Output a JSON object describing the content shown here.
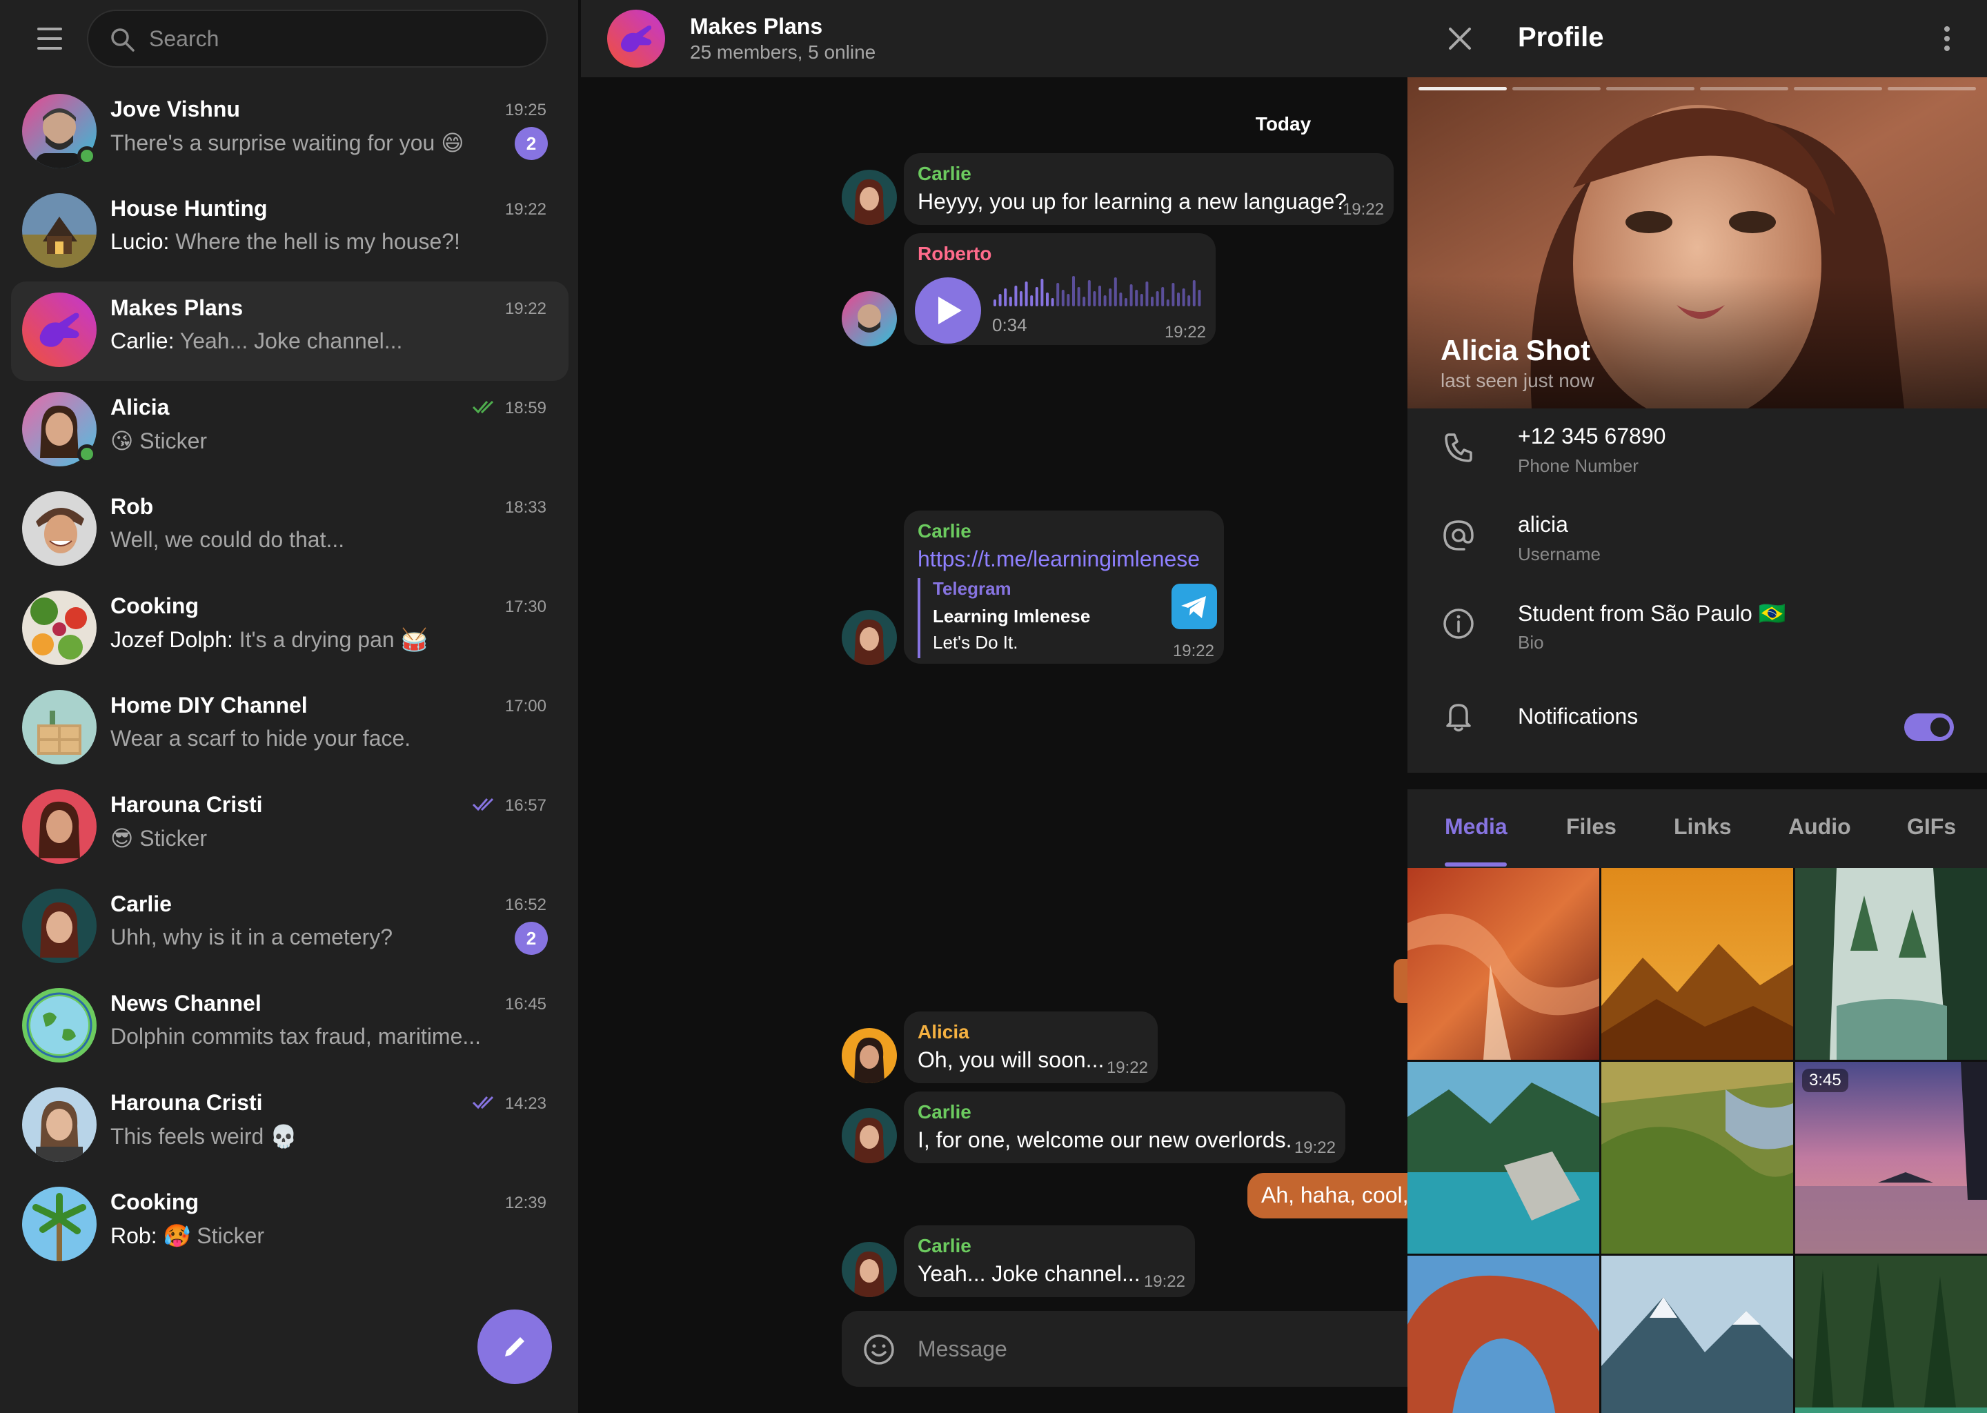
{
  "search": {
    "placeholder": "Search"
  },
  "chats": [
    {
      "title": "Jove Vishnu",
      "sender": "",
      "preview": "There's a surprise waiting for you 😄",
      "time": "19:25",
      "badge": "2",
      "online": true
    },
    {
      "title": "House Hunting",
      "sender": "Lucio:",
      "preview": " Where the hell is my house?!",
      "time": "19:22"
    },
    {
      "title": "Makes Plans",
      "sender": "Carlie:",
      "preview": " Yeah... Joke channel...",
      "time": "19:22",
      "active": true
    },
    {
      "title": "Alicia",
      "sender": "",
      "preview": "😘 Sticker",
      "time": "18:59",
      "read": "green",
      "online": true
    },
    {
      "title": "Rob",
      "sender": "",
      "preview": "Well, we could do that...",
      "time": "18:33"
    },
    {
      "title": "Cooking",
      "sender": "Jozef Dolph:",
      "preview": " It's a drying pan 🥁",
      "time": "17:30"
    },
    {
      "title": "Home DIY Channel",
      "sender": "",
      "preview": "Wear a scarf to hide your face.",
      "time": "17:00"
    },
    {
      "title": "Harouna Cristi",
      "sender": "",
      "preview": "😎 Sticker",
      "time": "16:57",
      "read": "purple"
    },
    {
      "title": "Carlie",
      "sender": "",
      "preview": "Uhh, why is it in a cemetery?",
      "time": "16:52",
      "badge": "2"
    },
    {
      "title": "News Channel",
      "sender": "",
      "preview": "Dolphin commits tax fraud, maritime...",
      "time": "16:45"
    },
    {
      "title": "Harouna Cristi",
      "sender": "",
      "preview": "This feels weird 💀",
      "time": "14:23",
      "read": "purple"
    },
    {
      "title": "Cooking",
      "sender": "Rob:",
      "preview": " 🥵 Sticker",
      "time": "12:39"
    }
  ],
  "conversation": {
    "title": "Makes Plans",
    "subtitle": "25 members, 5 online",
    "date_chip": "Today",
    "messages": {
      "m1": {
        "sender": "Carlie",
        "text": "Heyyy, you up for learning a new language?",
        "time": "19:22"
      },
      "m2": {
        "sender": "Roberto",
        "duration": "0:34",
        "time": "19:22"
      },
      "m3": {
        "sender": "Carlie",
        "link": "https://t.me/learningimlenese",
        "preview_site": "Telegram",
        "preview_title": "Learning Imlenese",
        "preview_desc": "Let's Do It.",
        "time": "19:22"
      },
      "m4": {
        "sender": "Alicia",
        "text": "Oh, you will soon...",
        "time": "19:22"
      },
      "m5": {
        "sender": "Carlie",
        "text": "I, for one, welcome our new overlords.",
        "time": "19:22"
      },
      "m6": {
        "text": "Ah, haha, cool,"
      },
      "m7": {
        "sender": "Carlie",
        "text": "Yeah... Joke channel...",
        "time": "19:22"
      }
    },
    "composer_placeholder": "Message"
  },
  "profile": {
    "header_title": "Profile",
    "name": "Alicia Shot",
    "last_seen": "last seen just now",
    "phone": "+12 345 67890",
    "phone_label": "Phone Number",
    "username": "alicia",
    "username_label": "Username",
    "bio": "Student from São Paulo 🇧🇷",
    "bio_label": "Bio",
    "notifications_label": "Notifications",
    "notifications_on": true,
    "tabs": [
      "Media",
      "Files",
      "Links",
      "Audio",
      "GIFs"
    ],
    "active_tab": "Media",
    "video_duration": "3:45"
  },
  "colors": {
    "accent": "#8774e1",
    "sender_green": "#6ccb5f",
    "sender_pink": "#ff6b8b",
    "sender_orange": "#f5b141",
    "outgoing_bubble": "#c4662f",
    "online": "#4fae4e"
  }
}
